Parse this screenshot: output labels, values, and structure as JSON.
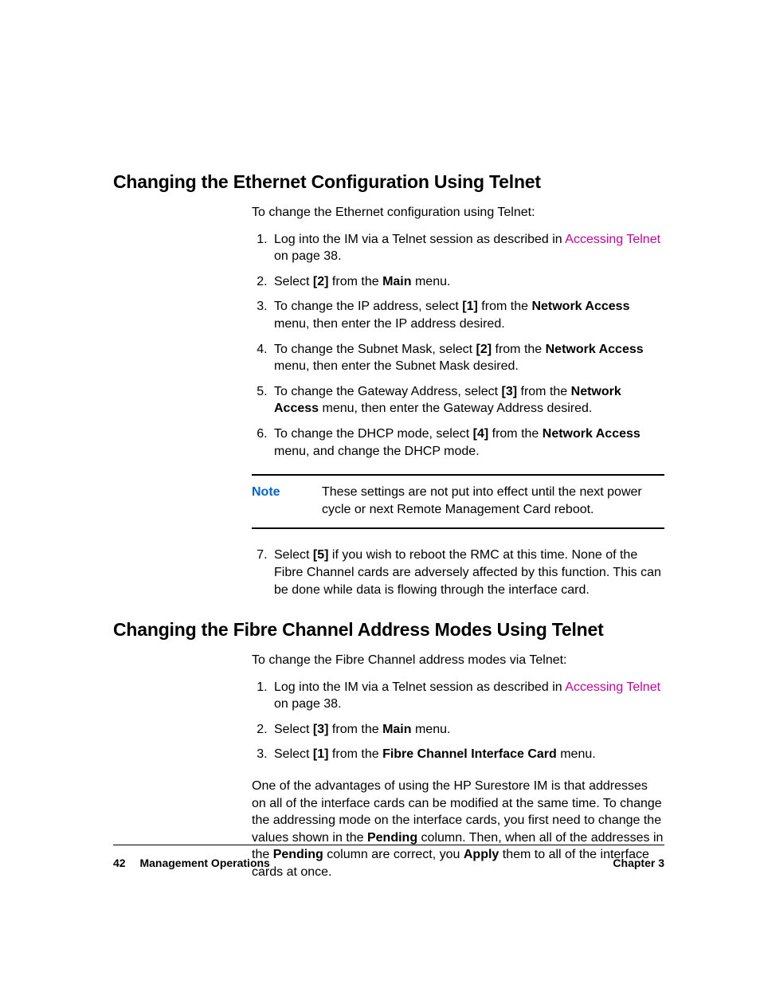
{
  "section1": {
    "heading": "Changing the Ethernet Configuration Using Telnet",
    "intro": "To change the Ethernet configuration using Telnet:",
    "steps": [
      {
        "pre": "Log into the IM via a Telnet session as described in ",
        "link": "Accessing Telnet",
        "post": " on page 38."
      },
      {
        "pre": "Select ",
        "b1": "[2]",
        "mid1": "  from the ",
        "b2": "Main",
        "post": " menu."
      },
      {
        "pre": "To change the IP address, select ",
        "b1": "[1]",
        "mid1": "  from the ",
        "b2": "Network Access",
        "post": " menu, then enter the IP address desired."
      },
      {
        "pre": "To change the Subnet Mask, select ",
        "b1": "[2]",
        "mid1": "  from the ",
        "b2": "Network Access",
        "post": " menu, then enter the Subnet Mask desired."
      },
      {
        "pre": "To change the Gateway Address, select ",
        "b1": "[3]",
        "mid1": " from the ",
        "b2": "Network Access",
        "post": " menu, then enter the Gateway Address desired."
      },
      {
        "pre": "To change the DHCP mode, select ",
        "b1": "[4]",
        "mid1": " from the ",
        "b2": "Network Access",
        "post": " menu, and change the DHCP mode."
      }
    ],
    "note_label": "Note",
    "note_text": "These settings are not put into effect until the next power cycle or next Remote Management Card reboot.",
    "step7": {
      "pre": "Select ",
      "b1": "[5]",
      "post": " if you wish to reboot the RMC at this time. None of the Fibre Channel cards are adversely affected by this function. This can be done while data is flowing through the interface card."
    }
  },
  "section2": {
    "heading": "Changing the Fibre Channel Address Modes Using Telnet",
    "intro": "To change the Fibre Channel address modes via Telnet:",
    "steps": [
      {
        "pre": "Log into the IM via a Telnet session as described in  ",
        "link": "Accessing Telnet",
        "post": " on page 38."
      },
      {
        "pre": "Select ",
        "b1": "[3]",
        "mid1": " from the ",
        "b2": "Main",
        "post": " menu."
      },
      {
        "pre": "Select ",
        "b1": "[1]",
        "mid1": "  from the ",
        "b2": "Fibre Channel Interface Card",
        "post": " menu."
      }
    ],
    "tail": {
      "t1": "One of the advantages of using the HP Surestore IM is that addresses on all of the interface cards can be modified at the same time. To change the addressing mode on the interface cards, you first need to change the values shown in the ",
      "b1": "Pending",
      "t2": " column. Then, when all of the addresses in the ",
      "b2": "Pending",
      "t3": " column are correct, you ",
      "b3": "Apply",
      "t4": " them to all of the interface cards at once."
    }
  },
  "footer": {
    "page": "42",
    "title": "Management Operations",
    "chapter": "Chapter 3"
  }
}
